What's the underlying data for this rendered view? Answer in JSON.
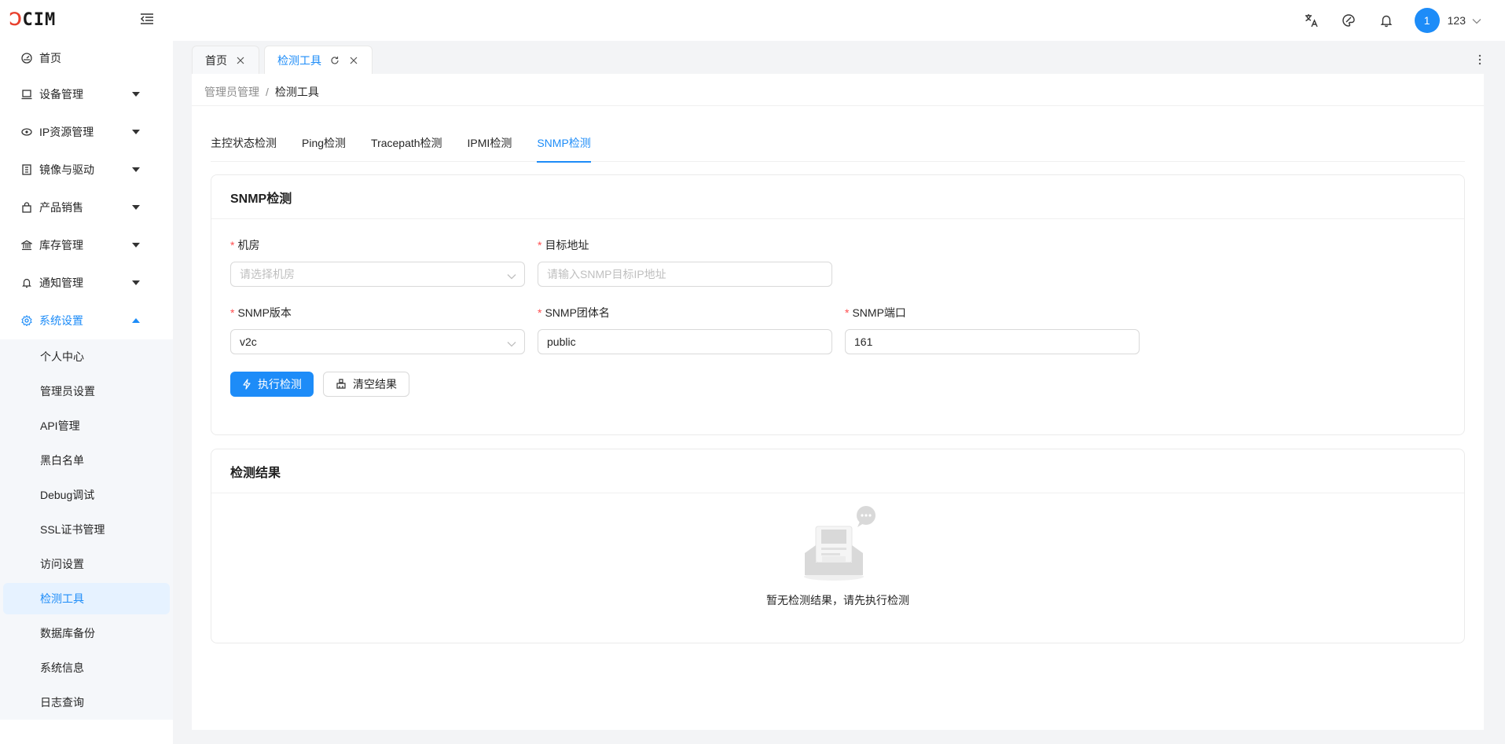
{
  "header": {
    "logo_prefix": "Ↄ",
    "logo_rest": "CIM",
    "user_badge": "1",
    "username": "123"
  },
  "sidebar": {
    "items": [
      {
        "label": "首页"
      },
      {
        "label": "设备管理"
      },
      {
        "label": "IP资源管理"
      },
      {
        "label": "镜像与驱动"
      },
      {
        "label": "产品销售"
      },
      {
        "label": "库存管理"
      },
      {
        "label": "通知管理"
      },
      {
        "label": "系统设置"
      }
    ],
    "sub_items": [
      {
        "label": "个人中心"
      },
      {
        "label": "管理员设置"
      },
      {
        "label": "API管理"
      },
      {
        "label": "黑白名单"
      },
      {
        "label": "Debug调试"
      },
      {
        "label": "SSL证书管理"
      },
      {
        "label": "访问设置"
      },
      {
        "label": "检测工具"
      },
      {
        "label": "数据库备份"
      },
      {
        "label": "系统信息"
      },
      {
        "label": "日志查询"
      }
    ]
  },
  "tabs": [
    {
      "label": "首页"
    },
    {
      "label": "检测工具"
    }
  ],
  "breadcrumb": {
    "parent": "管理员管理",
    "sep": "/",
    "current": "检测工具"
  },
  "subtabs": [
    {
      "label": "主控状态检测"
    },
    {
      "label": "Ping检测"
    },
    {
      "label": "Tracepath检测"
    },
    {
      "label": "IPMI检测"
    },
    {
      "label": "SNMP检测"
    }
  ],
  "form": {
    "title": "SNMP检测",
    "required_mark": "*",
    "room_label": "机房",
    "room_placeholder": "请选择机房",
    "target_label": "目标地址",
    "target_placeholder": "请输入SNMP目标IP地址",
    "version_label": "SNMP版本",
    "version_value": "v2c",
    "community_label": "SNMP团体名",
    "community_value": "public",
    "port_label": "SNMP端口",
    "port_value": "161",
    "run_button": "执行检测",
    "clear_button": "清空结果"
  },
  "result": {
    "title": "检测结果",
    "empty_text": "暂无检测结果，请先执行检测"
  },
  "colors": {
    "accent": "#1d8cf8",
    "required": "#ff4d4f"
  }
}
